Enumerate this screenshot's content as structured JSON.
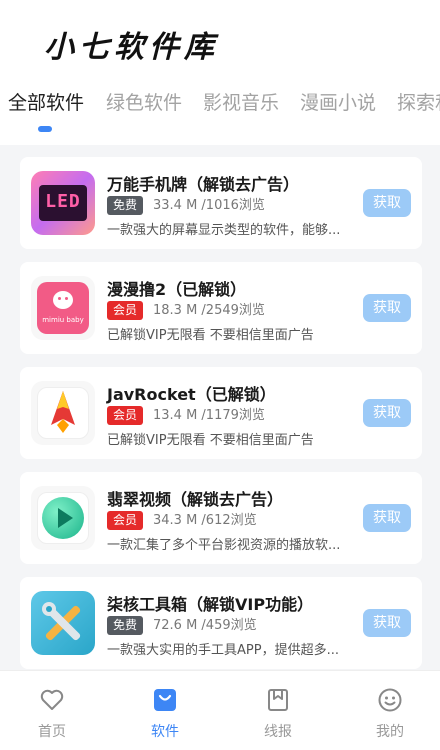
{
  "header": {
    "logo_text": "小七软件库"
  },
  "tabs": [
    {
      "label": "全部软件",
      "active": true
    },
    {
      "label": "绿色软件",
      "active": false
    },
    {
      "label": "影视音乐",
      "active": false
    },
    {
      "label": "漫画小说",
      "active": false
    },
    {
      "label": "探索和",
      "active": false
    }
  ],
  "apps": [
    {
      "title": "万能手机牌（解锁去广告）",
      "badge": "免费",
      "badge_type": "free",
      "meta": "33.4 M /1016浏览",
      "desc": "一款强大的屏幕显示类型的软件，能够...",
      "button": "获取",
      "icon": "led-icon",
      "icon_text": "LED"
    },
    {
      "title": "漫漫撸2（已解锁）",
      "badge": "会员",
      "badge_type": "vip",
      "meta": "18.3 M /2549浏览",
      "desc": "已解锁VIP无限看 不要相信里面广告",
      "button": "获取",
      "icon": "mimiu-baby-icon",
      "icon_text": "mimiu baby"
    },
    {
      "title": "JavRocket（已解锁）",
      "badge": "会员",
      "badge_type": "vip",
      "meta": "13.4 M /1179浏览",
      "desc": "已解锁VIP无限看 不要相信里面广告",
      "button": "获取",
      "icon": "rocket-icon"
    },
    {
      "title": "翡翠视频（解锁去广告）",
      "badge": "会员",
      "badge_type": "vip",
      "meta": "34.3 M /612浏览",
      "desc": "一款汇集了多个平台影视资源的播放软...",
      "button": "获取",
      "icon": "play-icon"
    },
    {
      "title": "柒核工具箱（解锁VIP功能）",
      "badge": "免费",
      "badge_type": "free",
      "meta": "72.6 M /459浏览",
      "desc": "一款强大实用的手工具APP，提供超多...",
      "button": "获取",
      "icon": "tools-icon"
    }
  ],
  "bottom_nav": [
    {
      "label": "首页",
      "icon": "heart-icon",
      "active": false
    },
    {
      "label": "软件",
      "icon": "software-icon",
      "active": true
    },
    {
      "label": "线报",
      "icon": "bookmark-icon",
      "active": false
    },
    {
      "label": "我的",
      "icon": "smile-icon",
      "active": false
    }
  ],
  "colors": {
    "accent": "#3d86f5",
    "button": "#9ccaf7",
    "vip_badge": "#e52a2a",
    "free_badge": "#555a60"
  }
}
